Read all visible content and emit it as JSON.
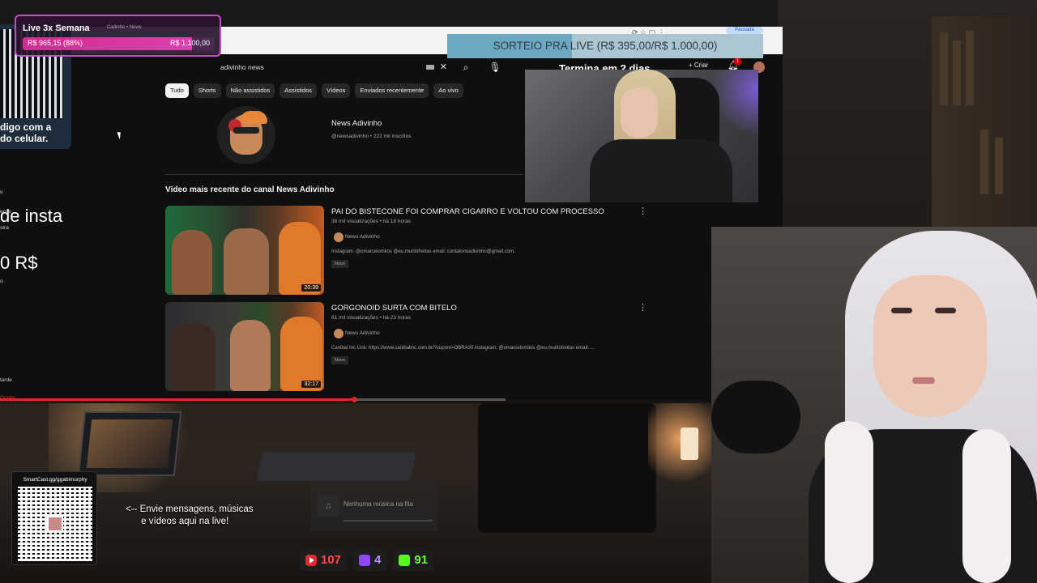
{
  "goal": {
    "title": "Live 3x Semana",
    "subtitle": "Cadinho • News",
    "current": "R$ 965,15 (88%)",
    "target": "R$ 1.100,00",
    "progress_pct": 88
  },
  "sorteio": {
    "text": "SORTEIO PRA LIVE (R$ 395,00/R$ 1.000,00)",
    "progress_pct": 39.5,
    "ends": "Termina em 2 dias"
  },
  "browser": {
    "paused_label": "Pausada"
  },
  "youtube": {
    "search_value": "adivinho news",
    "create_label": "Criar",
    "notif_count": "1",
    "chips": [
      "Tudo",
      "Shorts",
      "Não assistidos",
      "Assistidos",
      "Vídeos",
      "Enviados recentemente",
      "Ao vivo"
    ],
    "channel": {
      "name": "News Adivinho",
      "meta": "@newsadivinho • 222 mil inscritos"
    },
    "section_title": "Vídeo mais recente do canal News Adivinho",
    "videos": [
      {
        "title": "PAI DO BISTECONE FOI COMPRAR CIGARRO E VOLTOU COM PROCESSO",
        "meta": "38 mil visualizações • há 18 horas",
        "channel": "News Adivinho",
        "desc": "Instagram: @omarcelomiios @eu.murilofreitas email: contatonoadivinho@gmail.com.",
        "badge": "Novo",
        "duration": "20:39"
      },
      {
        "title": "GORGONOID SURTA COM BITELO",
        "meta": "81 mil visualizações • há 23 horas",
        "channel": "News Adivinho",
        "desc": "Canibal Inc Link: https://www.canibalinc.com.br/?cupom=OBRA30 instagram: @omarcelomiios @eu.murilofreitas email: ...",
        "badge": "Novo",
        "duration": "32:17"
      }
    ],
    "progress_pct": 70
  },
  "left": {
    "qr_caption": "digo com a\ndo celular.",
    "line1": "de insta",
    "line2": "0 R$",
    "tiny1": "o",
    "tiny2": "ecos",
    "tiny3": "stra",
    "tiny4": "o",
    "tiny5": "tarde",
    "tiny6": "Gostei"
  },
  "overlay": {
    "smartcast": "SmartCast.gg/ggabimurphy",
    "message": "<-- Envie mensagens, músicas\n      e vídeos aqui na live!",
    "music": "Nenhuma música na fila",
    "counters": {
      "youtube": "107",
      "twitch": "4",
      "kick": "91"
    }
  },
  "colors": {
    "goal_fill": "#d52a8e",
    "sorteio_fill": "#6da8c2",
    "yt_red": "#e3262e",
    "twitch": "#9146ff",
    "kick": "#53fc18"
  }
}
